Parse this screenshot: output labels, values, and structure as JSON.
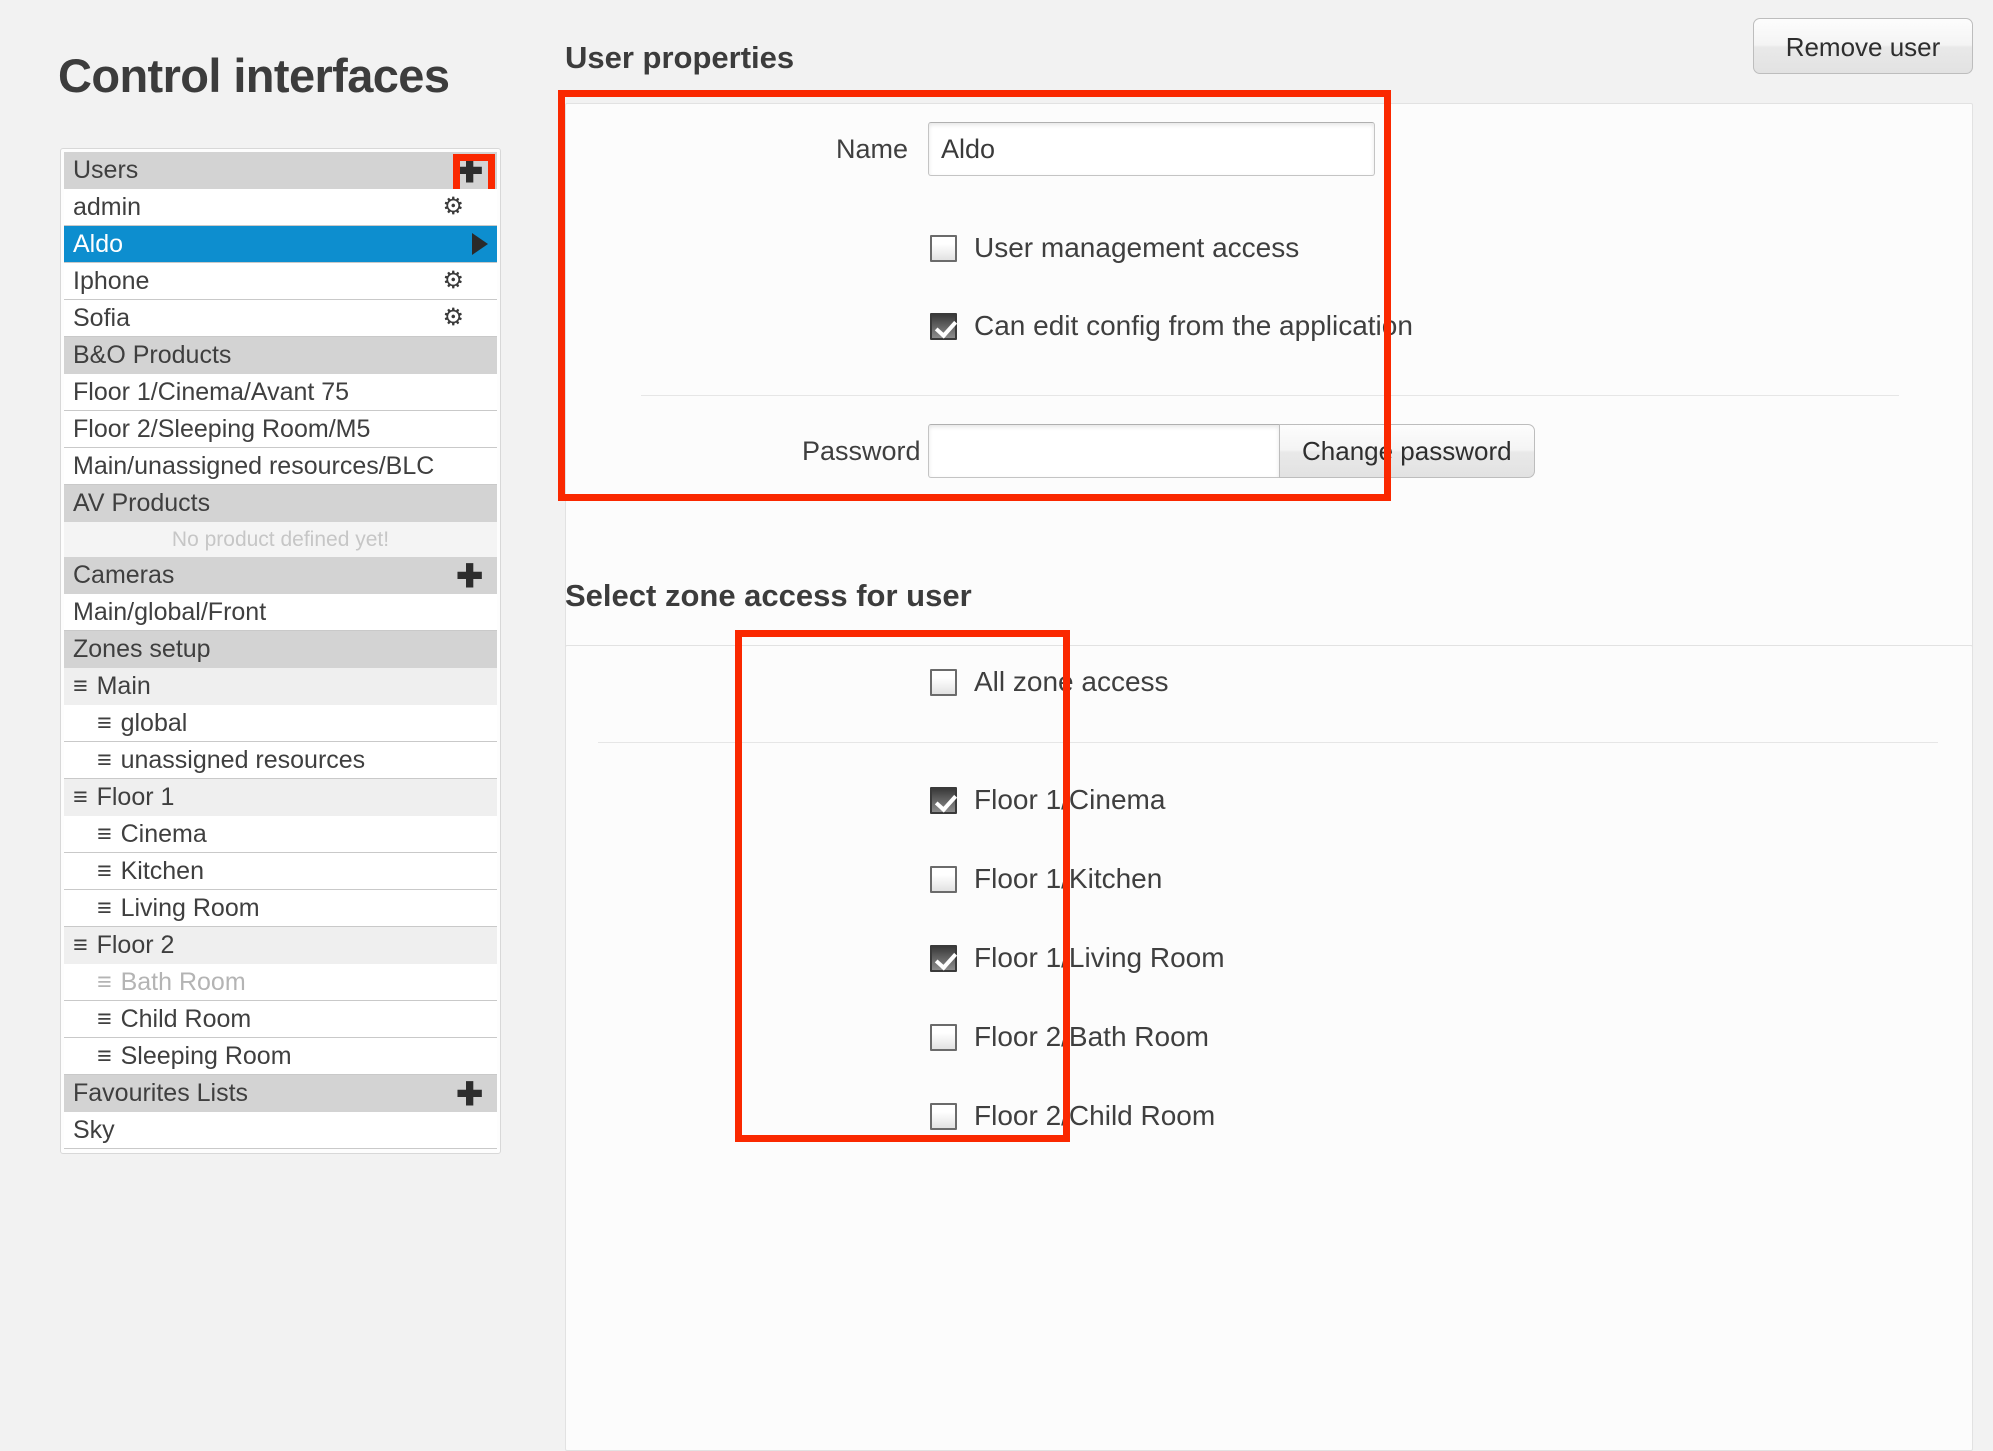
{
  "page": {
    "title": "Control interfaces"
  },
  "sidebar": {
    "sections": [
      {
        "header": "Users",
        "header_action": "add-user-plus-icon",
        "highlighted_action": true,
        "rows": [
          {
            "label": "admin",
            "type": "item",
            "accessory": "gear"
          },
          {
            "label": "Aldo",
            "type": "item",
            "accessory": "arrow",
            "selected": true
          },
          {
            "label": "Iphone",
            "type": "item",
            "accessory": "gear"
          },
          {
            "label": "Sofia",
            "type": "item",
            "accessory": "gear"
          }
        ]
      },
      {
        "header": "B&O Products",
        "rows": [
          {
            "label": "Floor 1/Cinema/Avant 75",
            "type": "item"
          },
          {
            "label": "Floor 2/Sleeping Room/M5",
            "type": "item"
          },
          {
            "label": "Main/unassigned resources/BLC",
            "type": "item"
          }
        ]
      },
      {
        "header": "AV Products",
        "rows": [
          {
            "label": "No product defined yet!",
            "type": "empty"
          }
        ]
      },
      {
        "header": "Cameras",
        "header_action": "add-camera-plus-icon",
        "rows": [
          {
            "label": "Main/global/Front",
            "type": "item"
          }
        ]
      },
      {
        "header": "Zones setup",
        "rows": [
          {
            "label": "Main",
            "type": "group"
          },
          {
            "label": "global",
            "type": "sub"
          },
          {
            "label": "unassigned resources",
            "type": "sub"
          },
          {
            "label": "Floor 1",
            "type": "group"
          },
          {
            "label": "Cinema",
            "type": "sub"
          },
          {
            "label": "Kitchen",
            "type": "sub"
          },
          {
            "label": "Living Room",
            "type": "sub"
          },
          {
            "label": "Floor 2",
            "type": "group"
          },
          {
            "label": "Bath Room",
            "type": "sub",
            "muted": true
          },
          {
            "label": "Child Room",
            "type": "sub"
          },
          {
            "label": "Sleeping Room",
            "type": "sub"
          }
        ]
      },
      {
        "header": "Favourites Lists",
        "header_action": "add-favourite-plus-icon",
        "rows": [
          {
            "label": "Sky",
            "type": "item"
          }
        ]
      }
    ],
    "drag_handle_glyph": "≡"
  },
  "user_properties": {
    "title": "User properties",
    "remove_user_label": "Remove user",
    "name_label": "Name",
    "name_value": "Aldo",
    "name_placeholder": "",
    "checkboxes": [
      {
        "label": "User management access",
        "checked": false
      },
      {
        "label": "Can edit config from the application",
        "checked": true
      }
    ],
    "password_label": "Password",
    "password_value": "",
    "password_placeholder": "",
    "change_password_label": "Change password"
  },
  "zone_access": {
    "title": "Select zone access for user",
    "all_zone": {
      "label": "All zone access",
      "checked": false
    },
    "zones": [
      {
        "label": "Floor 1/Cinema",
        "checked": true
      },
      {
        "label": "Floor 1/Kitchen",
        "checked": false
      },
      {
        "label": "Floor 1/Living Room",
        "checked": true
      },
      {
        "label": "Floor 2/Bath Room",
        "checked": false
      },
      {
        "label": "Floor 2/Child Room",
        "checked": false
      }
    ]
  },
  "annotations": {
    "accent_color": "#fa2800",
    "boxes": [
      "users-add-button",
      "user-properties-form",
      "zone-access-list"
    ]
  }
}
